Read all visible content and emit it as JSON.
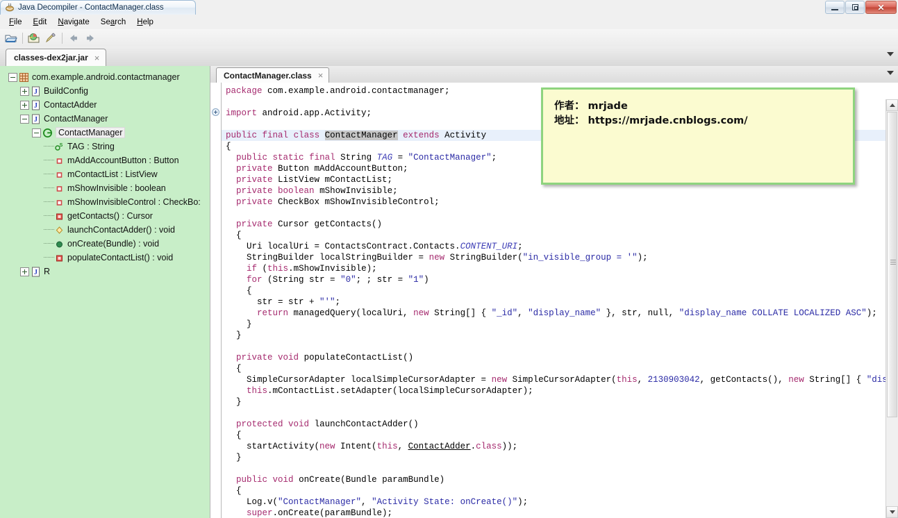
{
  "window": {
    "title": "Java Decompiler - ContactManager.class",
    "app_icon": "java-decompiler-icon",
    "controls": {
      "minimize": "—",
      "restore": "❐",
      "close": "✕"
    }
  },
  "menubar": {
    "items": [
      {
        "label": "File",
        "mnemonic": "F"
      },
      {
        "label": "Edit",
        "mnemonic": "E"
      },
      {
        "label": "Navigate",
        "mnemonic": "N"
      },
      {
        "label": "Search",
        "mnemonic": "a"
      },
      {
        "label": "Help",
        "mnemonic": "H"
      }
    ]
  },
  "toolbar": {
    "buttons": [
      {
        "name": "open-file-icon"
      },
      {
        "name": "open-type-icon"
      },
      {
        "name": "search-icon"
      },
      {
        "name": "back-arrow-icon"
      },
      {
        "name": "forward-arrow-icon"
      }
    ]
  },
  "jar_tabs": {
    "tabs": [
      {
        "label": "classes-dex2jar.jar",
        "close": "×",
        "active": true
      }
    ],
    "overflow_glyph": "▼"
  },
  "sidebar": {
    "tree": [
      {
        "label": "com.example.android.contactmanager",
        "icon": "package-icon",
        "depth": 0,
        "expander": "minus",
        "selected": false
      },
      {
        "label": "BuildConfig",
        "icon": "java-class-icon",
        "depth": 1,
        "expander": "plus",
        "selected": false
      },
      {
        "label": "ContactAdder",
        "icon": "java-class-icon",
        "depth": 1,
        "expander": "plus",
        "selected": false
      },
      {
        "label": "ContactManager",
        "icon": "java-class-icon",
        "depth": 1,
        "expander": "minus",
        "selected": false
      },
      {
        "label": "ContactManager",
        "icon": "class-green-icon",
        "depth": 2,
        "expander": "minus",
        "selected": true
      },
      {
        "label": "TAG : String",
        "icon": "static-field-icon",
        "depth": 3,
        "expander": "none",
        "selected": false
      },
      {
        "label": "mAddAccountButton : Button",
        "icon": "field-icon",
        "depth": 3,
        "expander": "none",
        "selected": false
      },
      {
        "label": "mContactList : ListView",
        "icon": "field-icon",
        "depth": 3,
        "expander": "none",
        "selected": false
      },
      {
        "label": "mShowInvisible : boolean",
        "icon": "field-icon",
        "depth": 3,
        "expander": "none",
        "selected": false
      },
      {
        "label": "mShowInvisibleControl : CheckBo:",
        "icon": "field-icon",
        "depth": 3,
        "expander": "none",
        "selected": false
      },
      {
        "label": "getContacts() : Cursor",
        "icon": "method-private-icon",
        "depth": 3,
        "expander": "none",
        "selected": false
      },
      {
        "label": "launchContactAdder() : void",
        "icon": "method-protected-icon",
        "depth": 3,
        "expander": "none",
        "selected": false
      },
      {
        "label": "onCreate(Bundle) : void",
        "icon": "method-public-icon",
        "depth": 3,
        "expander": "none",
        "selected": false
      },
      {
        "label": "populateContactList() : void",
        "icon": "method-private-icon",
        "depth": 3,
        "expander": "none",
        "selected": false
      },
      {
        "label": "R",
        "icon": "java-class-icon",
        "depth": 1,
        "expander": "plus",
        "selected": false
      }
    ]
  },
  "editor": {
    "tabs": [
      {
        "label": "ContactManager.class",
        "close": "×",
        "active": true
      }
    ],
    "overflow_glyph": "▼",
    "scrollbar": {
      "up_glyph": "▲",
      "down_glyph": "▼"
    },
    "fold_markers": [
      {
        "line": 2,
        "glyph": "+"
      }
    ],
    "code_lines": [
      "package com.example.android.contactmanager;",
      "",
      "import android.app.Activity;",
      "",
      "public final class ContactManager extends Activity",
      "{",
      "  public static final String TAG = \"ContactManager\";",
      "  private Button mAddAccountButton;",
      "  private ListView mContactList;",
      "  private boolean mShowInvisible;",
      "  private CheckBox mShowInvisibleControl;",
      "",
      "  private Cursor getContacts()",
      "  {",
      "    Uri localUri = ContactsContract.Contacts.CONTENT_URI;",
      "    StringBuilder localStringBuilder = new StringBuilder(\"in_visible_group = '\");",
      "    if (this.mShowInvisible);",
      "    for (String str = \"0\"; ; str = \"1\")",
      "    {",
      "      str = str + \"'\";",
      "      return managedQuery(localUri, new String[] { \"_id\", \"display_name\" }, str, null, \"display_name COLLATE LOCALIZED ASC\");",
      "    }",
      "  }",
      "",
      "  private void populateContactList()",
      "  {",
      "    SimpleCursorAdapter localSimpleCursorAdapter = new SimpleCursorAdapter(this, 2130903042, getContacts(), new String[] { \"display_name",
      "    this.mContactList.setAdapter(localSimpleCursorAdapter);",
      "  }",
      "",
      "  protected void launchContactAdder()",
      "  {",
      "    startActivity(new Intent(this, ContactAdder.class));",
      "  }",
      "",
      "  public void onCreate(Bundle paramBundle)",
      "  {",
      "    Log.v(\"ContactManager\", \"Activity State: onCreate()\");",
      "    super.onCreate(paramBundle);"
    ],
    "highlighted_token": "ContactManager",
    "current_line_index": 4
  },
  "callout": {
    "lines": [
      "作者： mrjade",
      "地址： https://mrjade.cnblogs.com/"
    ]
  },
  "colors": {
    "sidebar_bg": "#c8eec8",
    "callout_bg": "#fbfbd0",
    "callout_border": "#8ed47e",
    "keyword": "#a52a6e",
    "string": "#2a2aa5",
    "current_line": "#e8f0fb",
    "selection": "#c6c6c6",
    "titlebar": "#dfe9f3"
  }
}
